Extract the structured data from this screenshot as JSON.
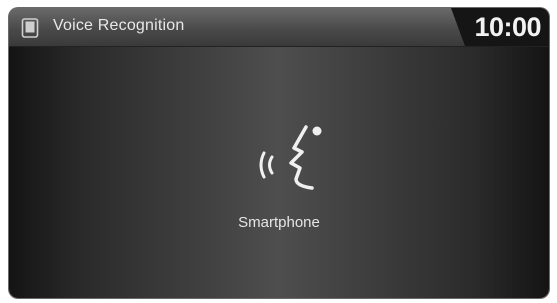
{
  "header": {
    "title": "Voice Recognition",
    "clock": "10:00",
    "icon": "smartphone-icon"
  },
  "main": {
    "icon": "voice-speaking-icon",
    "caption": "Smartphone"
  },
  "colors": {
    "header_bg": "#4a4a4a",
    "screen_center": "#4e4e4e",
    "screen_edge": "#141414",
    "text": "#e8e8e8"
  }
}
